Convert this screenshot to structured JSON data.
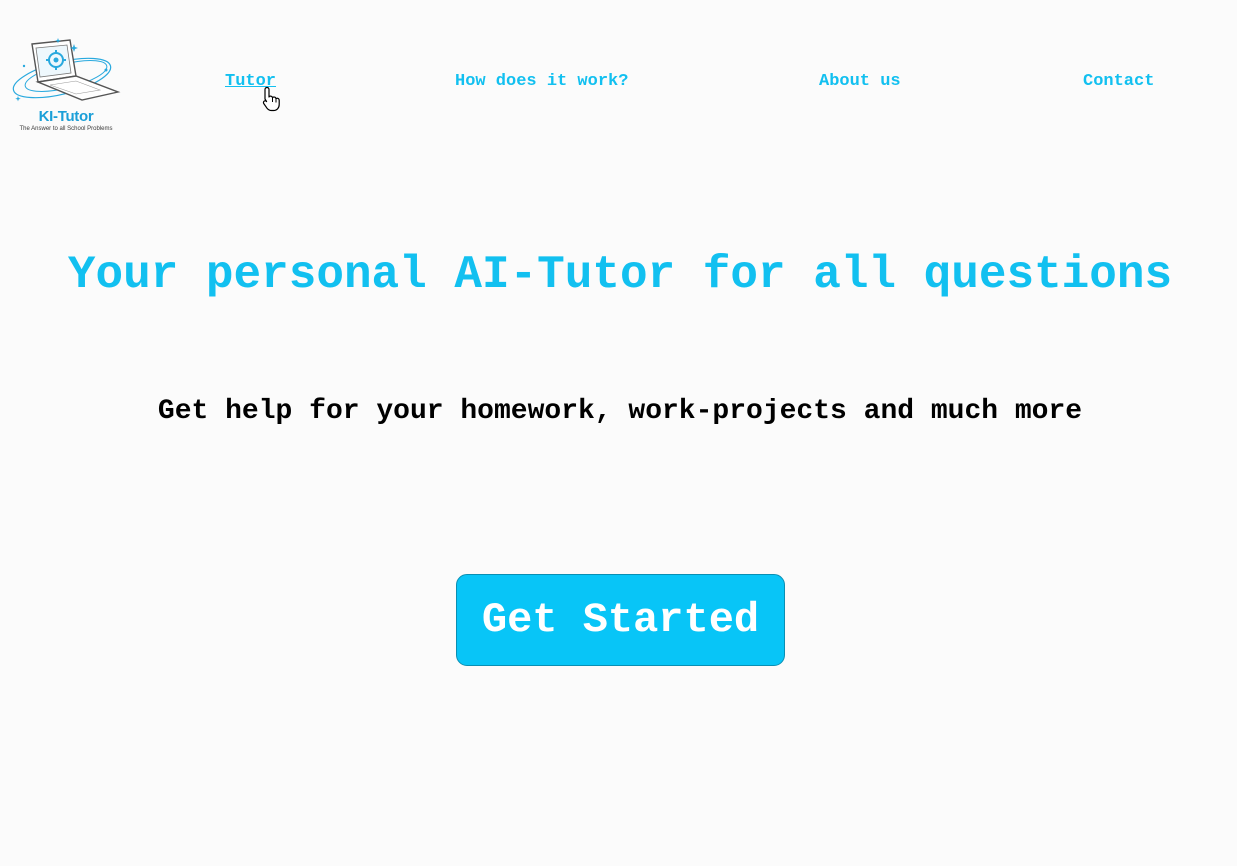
{
  "brand": {
    "name": "KI-Tutor",
    "tagline": "The Answer to all School Problems",
    "logo_icon": "laptop-gear-icon"
  },
  "nav": {
    "items": [
      {
        "label": "Tutor",
        "active": true
      },
      {
        "label": "How does it work?"
      },
      {
        "label": "About us"
      },
      {
        "label": "Contact"
      }
    ]
  },
  "hero": {
    "title": "Your personal AI-Tutor for all questions",
    "subtitle": "Get help for your homework, work-projects and much more",
    "cta_label": "Get Started"
  },
  "colors": {
    "accent": "#12c0f0",
    "button": "#08c5f7",
    "background": "#fbfbfb",
    "text": "#000000"
  }
}
